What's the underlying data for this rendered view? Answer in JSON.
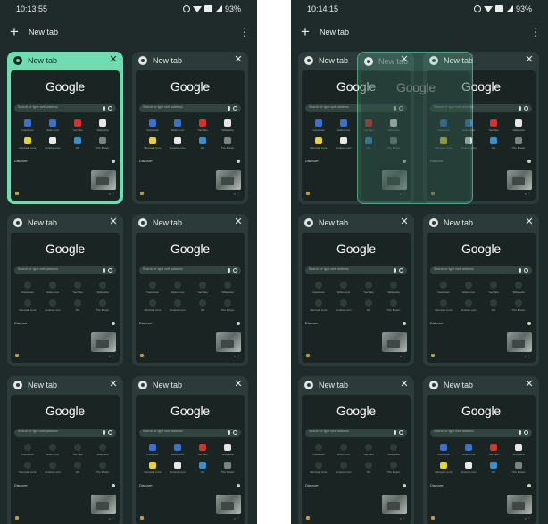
{
  "colors": {
    "background": "#1f2b2a",
    "card": "#2c3b39",
    "selected_card": "#6fdcb1"
  },
  "screens": [
    {
      "status": {
        "time": "10:13:55",
        "battery": "93%"
      },
      "toolbar": {
        "new_tab_label": "New tab"
      },
      "tabs": [
        {
          "title": "New tab",
          "selected": true,
          "tiles": true
        },
        {
          "title": "New tab",
          "selected": false,
          "tiles": true
        },
        {
          "title": "New tab",
          "selected": false,
          "tiles": false
        },
        {
          "title": "New tab",
          "selected": false,
          "tiles": false
        },
        {
          "title": "New tab",
          "selected": false,
          "tiles": false
        },
        {
          "title": "New tab",
          "selected": false,
          "tiles": true
        }
      ]
    },
    {
      "status": {
        "time": "10:14:15",
        "battery": "93%"
      },
      "toolbar": {
        "new_tab_label": "New tab"
      },
      "drag_ghost": {
        "title": "New tab"
      },
      "tabs": [
        {
          "title": "New tab",
          "selected": false,
          "tiles": true
        },
        {
          "title": "New tab",
          "selected": false,
          "tiles": true
        },
        {
          "title": "New tab",
          "selected": false,
          "tiles": false
        },
        {
          "title": "New tab",
          "selected": false,
          "tiles": false
        },
        {
          "title": "New tab",
          "selected": false,
          "tiles": false
        },
        {
          "title": "New tab",
          "selected": false,
          "tiles": true
        }
      ]
    }
  ],
  "preview": {
    "logo": "Google",
    "search_placeholder": "Search or type web address",
    "discover_label": "Discover",
    "tiles": [
      {
        "label": "Facebook",
        "icon": "facebook-icon",
        "color": "#3b6fd8"
      },
      {
        "label": "Globo.com",
        "icon": "globo-icon",
        "color": "#3a72c9"
      },
      {
        "label": "YouTube",
        "icon": "youtube-icon",
        "color": "#d6332b"
      },
      {
        "label": "Wikipedia",
        "icon": "wikipedia-icon",
        "color": "#e6e6e6"
      },
      {
        "label": "Mercado Livre",
        "icon": "mercado-livre-icon",
        "color": "#e8d230"
      },
      {
        "label": "Amazon.com",
        "icon": "amazon-icon",
        "color": "#e9e9e9"
      },
      {
        "label": "Olx",
        "icon": "olx-icon",
        "color": "#3a8fd0"
      },
      {
        "label": "The Brown",
        "icon": "site-icon",
        "color": "#7b8583"
      }
    ]
  }
}
